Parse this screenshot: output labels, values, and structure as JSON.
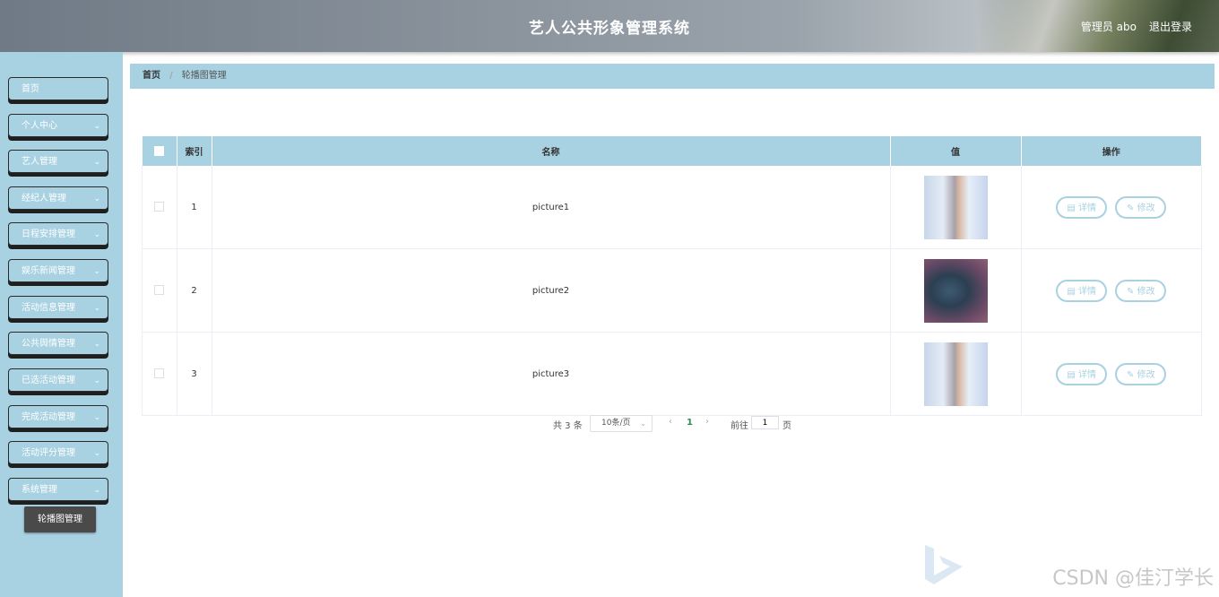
{
  "header": {
    "title": "艺人公共形象管理系统",
    "user": "管理员 abo",
    "logout": "退出登录"
  },
  "sidebar": {
    "items": [
      {
        "label": "首页",
        "has_chevron": false
      },
      {
        "label": "个人中心",
        "has_chevron": true
      },
      {
        "label": "艺人管理",
        "has_chevron": true
      },
      {
        "label": "经纪人管理",
        "has_chevron": true
      },
      {
        "label": "日程安排管理",
        "has_chevron": true
      },
      {
        "label": "娱乐新闻管理",
        "has_chevron": true
      },
      {
        "label": "活动信息管理",
        "has_chevron": true
      },
      {
        "label": "公共舆情管理",
        "has_chevron": true
      },
      {
        "label": "已选活动管理",
        "has_chevron": true
      },
      {
        "label": "完成活动管理",
        "has_chevron": true
      },
      {
        "label": "活动评分管理",
        "has_chevron": true
      },
      {
        "label": "系统管理",
        "has_chevron": true
      }
    ],
    "sub_item": "轮播图管理"
  },
  "breadcrumb": {
    "home": "首页",
    "separator": "/",
    "current": "轮播图管理"
  },
  "table": {
    "columns": [
      "索引",
      "名称",
      "值",
      "操作"
    ],
    "rows": [
      {
        "index": "1",
        "name": "picture1",
        "image": "portrait-thumbnail"
      },
      {
        "index": "2",
        "name": "picture2",
        "image": "dark-round-thumbnail"
      },
      {
        "index": "3",
        "name": "picture3",
        "image": "portrait-thumbnail"
      }
    ],
    "actions": {
      "detail": "详情",
      "edit": "修改"
    }
  },
  "pagination": {
    "total": "共 3 条",
    "page_size": "10条/页",
    "current_page": "1",
    "goto_label": "前往",
    "goto_value": "1",
    "page_suffix": "页"
  },
  "watermark": "CSDN @佳汀学长",
  "colors": {
    "accent": "#a8d1e2",
    "submenu_active": "#4a4a4a",
    "page_active": "#2e8b57"
  }
}
